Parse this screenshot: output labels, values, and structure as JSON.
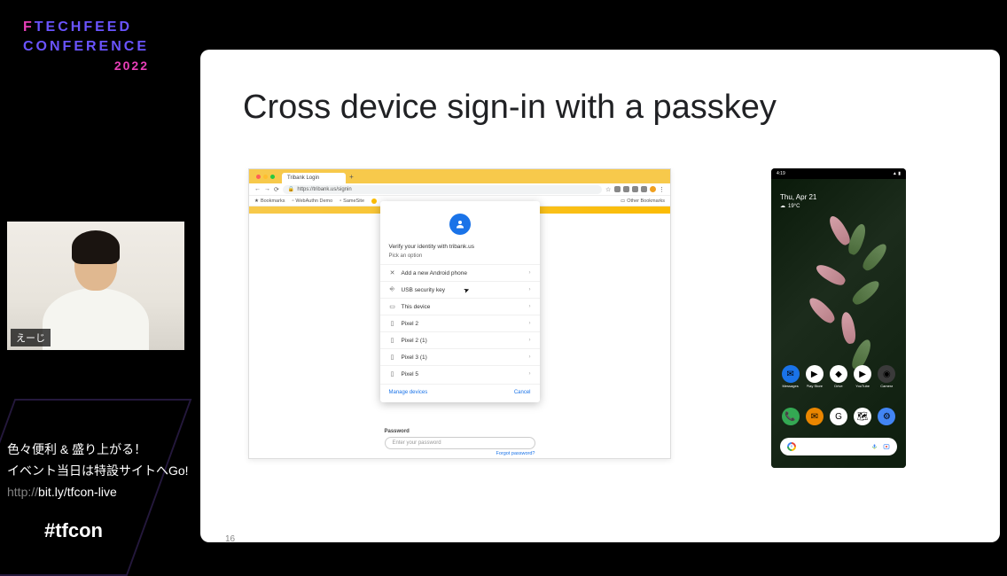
{
  "logo": {
    "line1_pre": "F",
    "line1": "TECHFEED",
    "line2": "CONFERENCE",
    "year": "2022"
  },
  "webcam": {
    "name": "えーじ"
  },
  "side": {
    "line1": "色々便利 & 盛り上がる！",
    "line2": "イベント当日は特設サイトへGo!",
    "url_prefix": "http://",
    "url": "bit.ly/tfcon-live",
    "hashtag": "#tfcon"
  },
  "slide": {
    "title": "Cross device sign-in with a passkey",
    "page_number": "16"
  },
  "browser": {
    "tab_title": "Tribank Login",
    "url_display": "https://tribank.us/signin",
    "bookmarks": [
      "Bookmarks",
      "WebAuthn Demo",
      "SameSite"
    ],
    "other_bookmarks": "Other Bookmarks",
    "dialog": {
      "verify": "Verify your identity with tribank.us",
      "pick": "Pick an option",
      "options": [
        {
          "icon": "✕",
          "label": "Add a new Android phone"
        },
        {
          "icon": "⎆",
          "label": "USB security key"
        },
        {
          "icon": "▭",
          "label": "This device"
        },
        {
          "icon": "▯",
          "label": "Pixel 2"
        },
        {
          "icon": "▯",
          "label": "Pixel 2 (1)"
        },
        {
          "icon": "▯",
          "label": "Pixel 3 (1)"
        },
        {
          "icon": "▯",
          "label": "Pixel 5"
        }
      ],
      "manage": "Manage devices",
      "cancel": "Cancel"
    },
    "password_section": {
      "label": "Password",
      "placeholder": "Enter your password",
      "forgot": "Forgot password?"
    }
  },
  "phone": {
    "time": "4:19",
    "date": "Thu, Apr 21",
    "temp": "19°C",
    "apps_row1": [
      {
        "label": "Messages",
        "color": "#1a73e8",
        "glyph": "✉"
      },
      {
        "label": "Play Store",
        "color": "#fff",
        "glyph": "▶"
      },
      {
        "label": "Drive",
        "color": "#fff",
        "glyph": "◆"
      },
      {
        "label": "YouTube",
        "color": "#fff",
        "glyph": "▶"
      },
      {
        "label": "Camera",
        "color": "#3a3a3a",
        "glyph": "◉"
      }
    ],
    "apps_row2": [
      {
        "label": "",
        "color": "#34a853",
        "glyph": "📞"
      },
      {
        "label": "",
        "color": "#ea8600",
        "glyph": "✉"
      },
      {
        "label": "",
        "color": "#fff",
        "glyph": "G"
      },
      {
        "label": "",
        "color": "#fff",
        "glyph": "🗺"
      },
      {
        "label": "",
        "color": "#4285f4",
        "glyph": "⚙"
      }
    ]
  }
}
